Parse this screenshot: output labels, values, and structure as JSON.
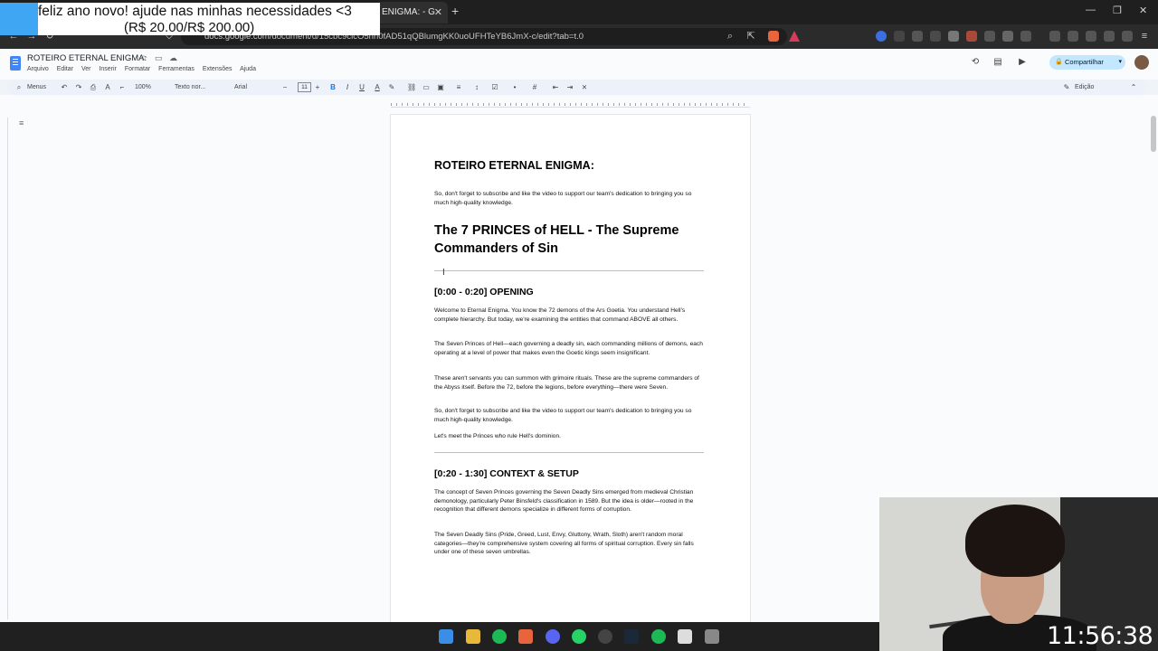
{
  "browser": {
    "tab_title": "ENIGMA: - G",
    "url": "docs.google.com/document/d/15cbc9clcO5hn0fAD51qQBlumgKK0uoUFHTeYB6JmX-c/edit?tab=t.0",
    "colors": {
      "chrome_bg": "#1f1f1f",
      "address_bg": "#2b2b2b"
    }
  },
  "overlay": {
    "donation_line1": "feliz ano novo! ajude nas minhas necessidades <3",
    "donation_line2": "(R$ 20.00/R$ 200.00)",
    "progress": 0.1,
    "accent": "#3ea6f2"
  },
  "docs": {
    "title": "ROTEIRO ETERNAL ENIGMA:",
    "menu": [
      "Arquivo",
      "Editar",
      "Ver",
      "Inserir",
      "Formatar",
      "Ferramentas",
      "Extensões",
      "Ajuda"
    ],
    "share_label": "Compartilhar",
    "toolbar": {
      "menus": "Menus",
      "zoom": "100%",
      "style": "Texto nor...",
      "font": "Arial",
      "size": "11",
      "mode": "Edição"
    }
  },
  "document": {
    "heading": "ROTEIRO ETERNAL ENIGMA:",
    "intro": "So, don't forget to subscribe and like the video to support our team's dedication to bringing you so much high-quality knowledge.",
    "title": "The 7 PRINCES of HELL - The Supreme Commanders of Sin",
    "section1_heading": "[0:00 - 0:20] OPENING",
    "section1_paragraphs": [
      "Welcome to Eternal Enigma. You know the 72 demons of the Ars Goetia. You understand Hell's complete hierarchy. But today, we're examining the entities that command ABOVE all others.",
      "The Seven Princes of Hell—each governing a deadly sin, each commanding millions of demons, each operating at a level of power that makes even the Goetic kings seem insignificant.",
      "These aren't servants you can summon with grimoire rituals. These are the supreme commanders of the Abyss itself. Before the 72, before the legions, before everything—there were Seven.",
      "So, don't forget to subscribe and like the video to support our team's dedication to bringing you so much high-quality knowledge.",
      "Let's meet the Princes who rule Hell's dominion."
    ],
    "section2_heading": "[0:20 - 1:30] CONTEXT & SETUP",
    "section2_paragraphs": [
      "The concept of Seven Princes governing the Seven Deadly Sins emerged from medieval Christian demonology, particularly Peter Binsfeld's classification in 1589. But the idea is older—rooted in the recognition that different demons specialize in different forms of corruption.",
      "The Seven Deadly Sins (Pride, Greed, Lust, Envy, Gluttony, Wrath, Sloth) aren't random moral categories—they're comprehensive system covering all forms of spiritual corruption. Every sin falls under one of these seven umbrellas."
    ]
  },
  "stream": {
    "clock": "11:56:38"
  }
}
